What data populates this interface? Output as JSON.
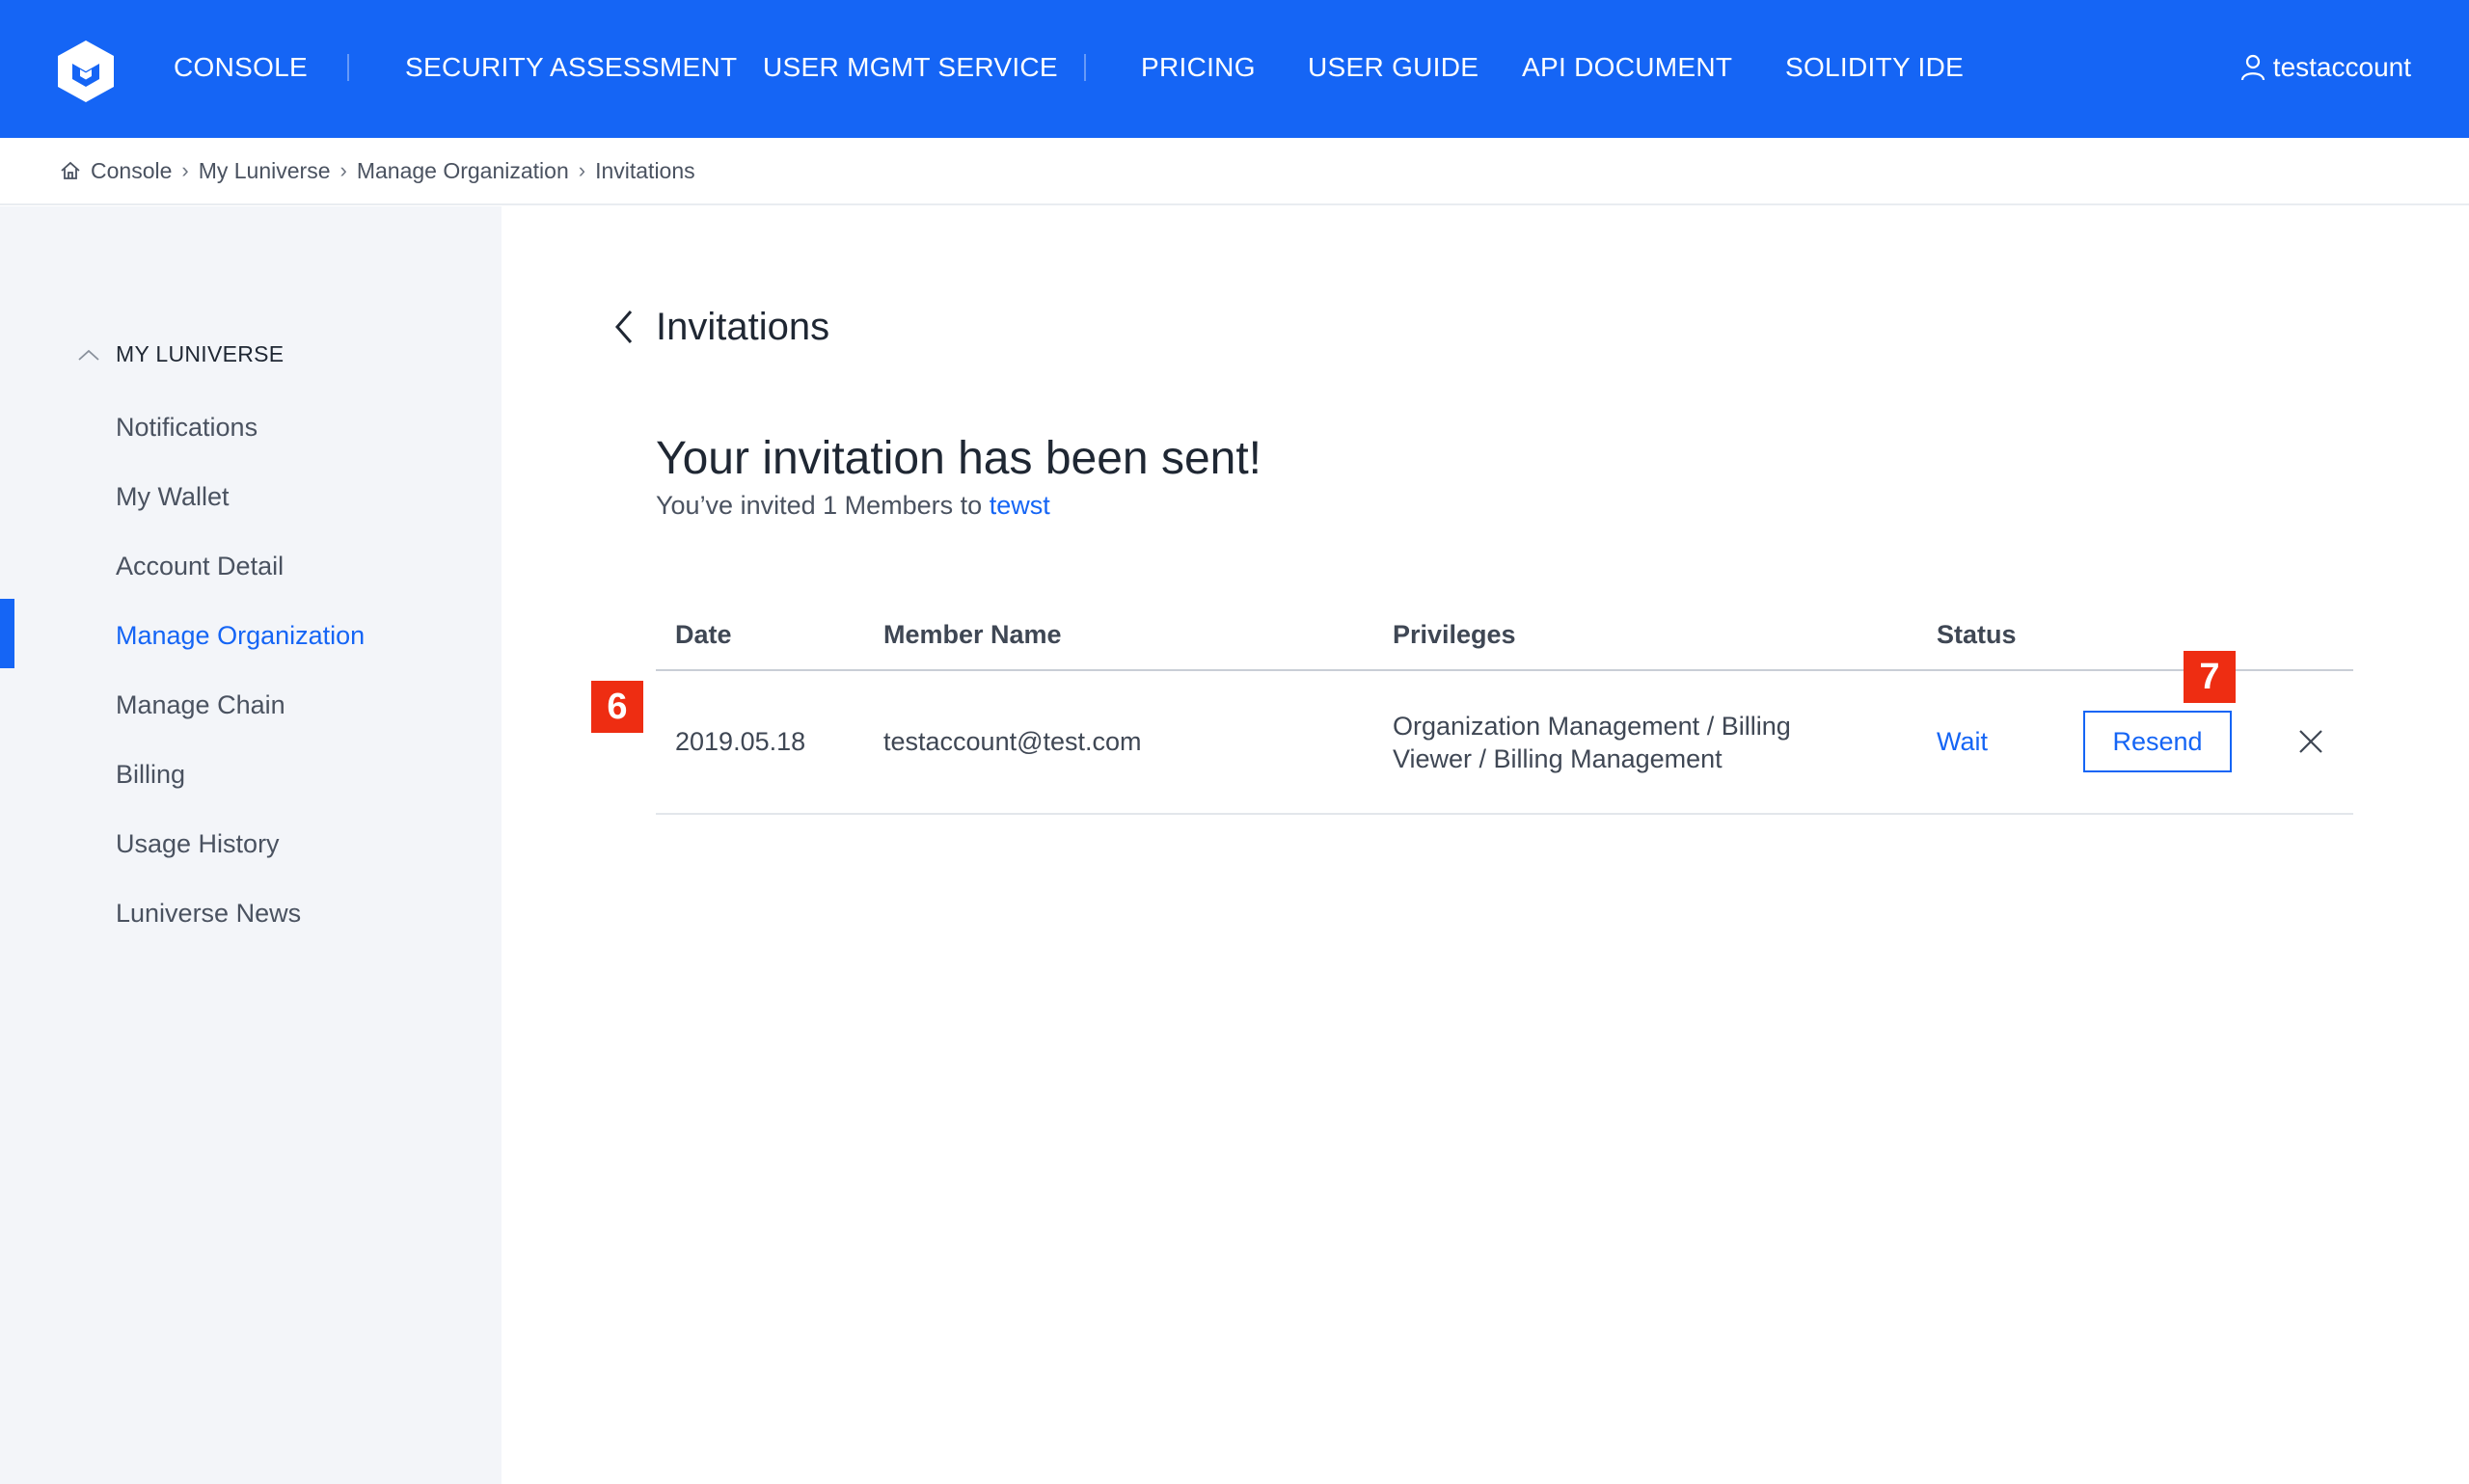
{
  "topnav": {
    "items": [
      {
        "label": "CONSOLE"
      },
      {
        "label": "SECURITY ASSESSMENT"
      },
      {
        "label": "USER MGMT SERVICE"
      },
      {
        "label": "PRICING"
      },
      {
        "label": "USER GUIDE"
      },
      {
        "label": "API DOCUMENT"
      },
      {
        "label": "SOLIDITY IDE"
      }
    ],
    "user": "testaccount",
    "icons": {
      "logo": "luniverse-logo",
      "user": "user-icon"
    },
    "colors": {
      "bar": "#1565f5"
    }
  },
  "breadcrumb": [
    "Console",
    "My Luniverse",
    "Manage Organization",
    "Invitations"
  ],
  "sidebar": {
    "section": "MY LUNIVERSE",
    "items": [
      {
        "label": "Notifications"
      },
      {
        "label": "My Wallet"
      },
      {
        "label": "Account Detail"
      },
      {
        "label": "Manage Organization"
      },
      {
        "label": "Manage Chain"
      },
      {
        "label": "Billing"
      },
      {
        "label": "Usage History"
      },
      {
        "label": "Luniverse News"
      }
    ],
    "active": "Manage Organization"
  },
  "main": {
    "title": "Invitations",
    "headline": "Your invitation has been sent!",
    "sub_prefix": "You’ve invited 1 Members to",
    "org_name": "tewst",
    "table": {
      "headers": [
        "Date",
        "Member Name",
        "Privileges",
        "Status"
      ],
      "rows": [
        {
          "date": "2019.05.18",
          "member": "testaccount@test.com",
          "privileges_line1": "Organization Management / Billing",
          "privileges_line2": "Viewer / Billing Management",
          "status": "Wait",
          "action": "Resend"
        }
      ]
    }
  },
  "markers": [
    "6",
    "7"
  ],
  "colors": {
    "accent": "#1565f5",
    "marker": "#ee2d12"
  }
}
